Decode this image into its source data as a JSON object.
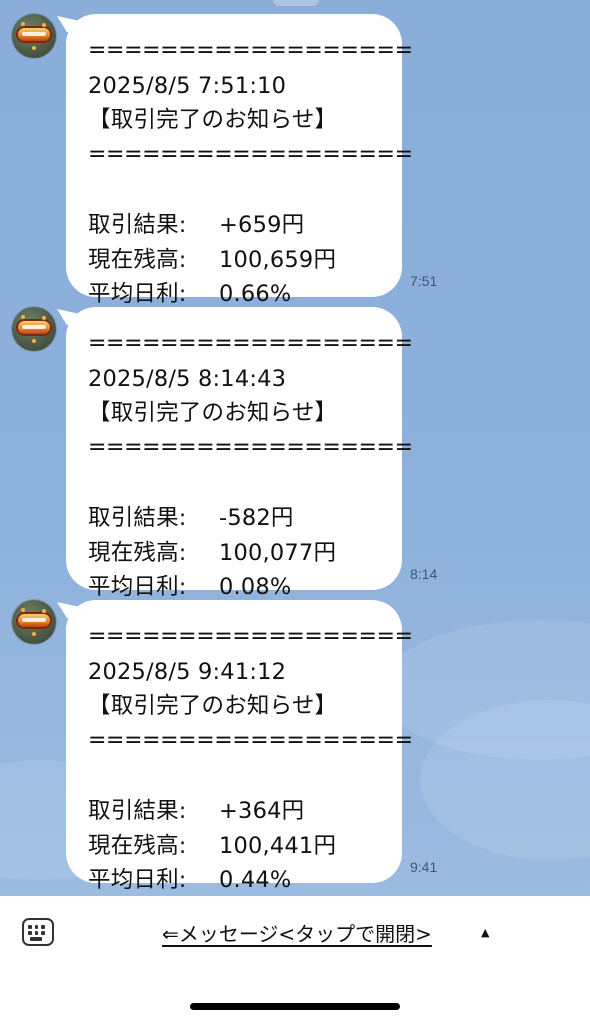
{
  "messages": [
    {
      "separator": "==================",
      "datetime": "2025/8/5 7:51:10",
      "title": "【取引完了のお知らせ】",
      "result_label": "取引結果:",
      "result_value": "+659円",
      "balance_label": "現在残高:",
      "balance_value": "100,659円",
      "daily_label": "平均日利:",
      "daily_value": "0.66%",
      "time": "7:51"
    },
    {
      "separator": "==================",
      "datetime": "2025/8/5 8:14:43",
      "title": "【取引完了のお知らせ】",
      "result_label": "取引結果:",
      "result_value": "-582円",
      "balance_label": "現在残高:",
      "balance_value": "100,077円",
      "daily_label": "平均日利:",
      "daily_value": "0.08%",
      "time": "8:14"
    },
    {
      "separator": "==================",
      "datetime": "2025/8/5 9:41:12",
      "title": "【取引完了のお知らせ】",
      "result_label": "取引結果:",
      "result_value": "+364円",
      "balance_label": "現在残高:",
      "balance_value": "100,441円",
      "daily_label": "平均日利:",
      "daily_value": "0.44%",
      "time": "9:41"
    }
  ],
  "input_bar": {
    "keyboard_icon": "keyboard-icon",
    "menu_label": "⇐メッセージ<タップで開閉>",
    "menu_arrow": "▲"
  },
  "colors": {
    "chat_background": "#8db1dc",
    "bubble": "#ffffff",
    "timestamp": "#3f5677"
  }
}
